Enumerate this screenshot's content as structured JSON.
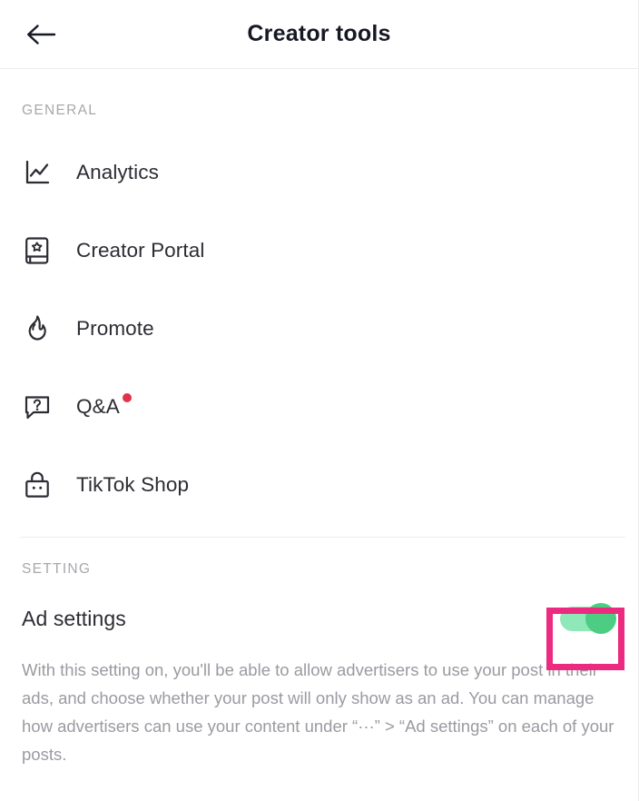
{
  "header": {
    "title": "Creator tools",
    "back_icon": "arrow-left-icon"
  },
  "sections": {
    "general": {
      "label": "GENERAL",
      "items": [
        {
          "label": "Analytics",
          "icon": "analytics-chart-icon",
          "badge": false
        },
        {
          "label": "Creator Portal",
          "icon": "book-portal-icon",
          "badge": false
        },
        {
          "label": "Promote",
          "icon": "flame-icon",
          "badge": false
        },
        {
          "label": "Q&A",
          "icon": "question-bubble-icon",
          "badge": true
        },
        {
          "label": "TikTok Shop",
          "icon": "shopping-bag-icon",
          "badge": false
        }
      ]
    },
    "setting": {
      "label": "SETTING",
      "ad_settings": {
        "title": "Ad settings",
        "toggle_state": "on",
        "description": "With this setting on, you'll be able to allow advertisers to use your post in their ads, and choose whether your post will only show as an ad. You can manage how advertisers can use your content under “···” > “Ad settings” on each of your posts."
      }
    }
  },
  "colors": {
    "toggle_track_on": "#8fe8b8",
    "toggle_knob_on": "#4ccd83",
    "badge_dot": "#e3314a",
    "annotation_box": "#ec2a7f",
    "title_text": "#161823",
    "section_label_text": "#a8a8ad",
    "description_text": "#9a9aa1"
  }
}
